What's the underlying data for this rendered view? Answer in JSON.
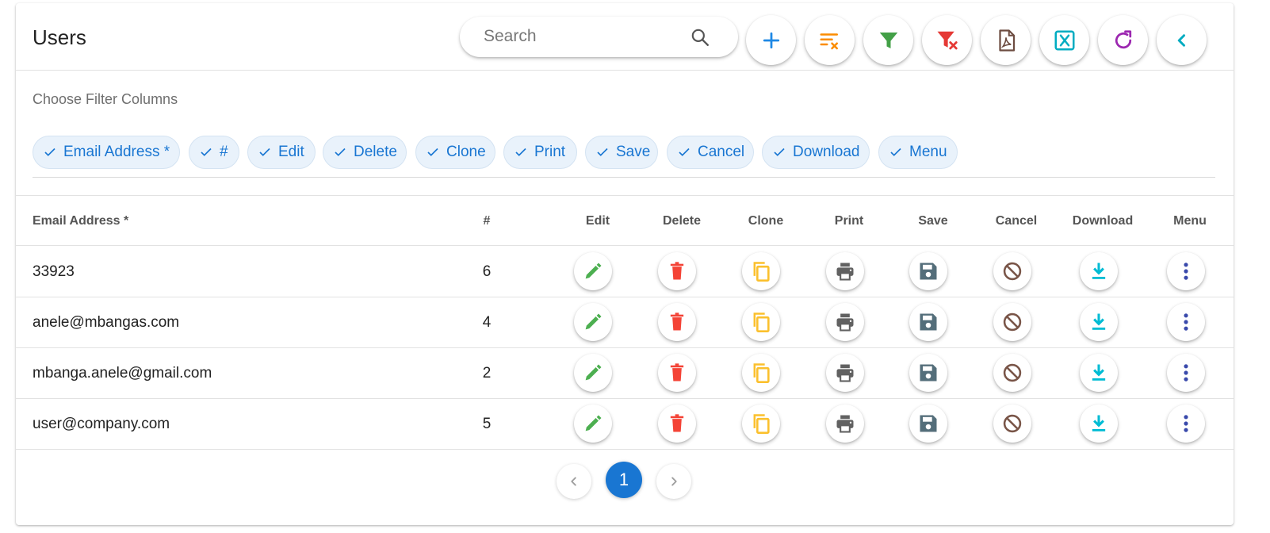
{
  "header": {
    "title": "Users",
    "search_placeholder": "Search",
    "toolbar": [
      {
        "name": "add-button",
        "icon": "plus-icon",
        "color": "#1e88e5"
      },
      {
        "name": "clear-sort-button",
        "icon": "sort-clear-icon",
        "color": "#fb8c00"
      },
      {
        "name": "filter-button",
        "icon": "funnel-icon",
        "color": "#43a047"
      },
      {
        "name": "clear-filter-button",
        "icon": "funnel-clear-icon",
        "color": "#e53935"
      },
      {
        "name": "export-pdf-button",
        "icon": "pdf-icon",
        "color": "#6d4c41"
      },
      {
        "name": "export-excel-button",
        "icon": "excel-icon",
        "color": "#00acc1"
      },
      {
        "name": "refresh-button",
        "icon": "refresh-icon",
        "color": "#9c27b0"
      },
      {
        "name": "collapse-button",
        "icon": "chevron-left-icon",
        "color": "#00acc1"
      }
    ]
  },
  "filter": {
    "label": "Choose Filter Columns",
    "chips": [
      "Email Address *",
      "#",
      "Edit",
      "Delete",
      "Clone",
      "Print",
      "Save",
      "Cancel",
      "Download",
      "Menu"
    ]
  },
  "table": {
    "columns": [
      "Email Address *",
      "#",
      "Edit",
      "Delete",
      "Clone",
      "Print",
      "Save",
      "Cancel",
      "Download",
      "Menu"
    ],
    "actions": [
      {
        "name": "edit",
        "icon": "pencil-icon",
        "color": "#4caf50"
      },
      {
        "name": "delete",
        "icon": "trash-icon",
        "color": "#f44336"
      },
      {
        "name": "clone",
        "icon": "copy-icon",
        "color": "#fbc02d"
      },
      {
        "name": "print",
        "icon": "printer-icon",
        "color": "#616161"
      },
      {
        "name": "save",
        "icon": "floppy-icon",
        "color": "#546e7a"
      },
      {
        "name": "cancel",
        "icon": "block-icon",
        "color": "#795548"
      },
      {
        "name": "download",
        "icon": "download-icon",
        "color": "#00bcd4"
      },
      {
        "name": "menu",
        "icon": "more-vert-icon",
        "color": "#3949ab"
      }
    ],
    "rows": [
      {
        "email": "33923",
        "num": "6"
      },
      {
        "email": "anele@mbangas.com",
        "num": "4"
      },
      {
        "email": "mbanga.anele@gmail.com",
        "num": "2"
      },
      {
        "email": "user@company.com",
        "num": "5"
      }
    ]
  },
  "pagination": {
    "current_page": "1"
  }
}
